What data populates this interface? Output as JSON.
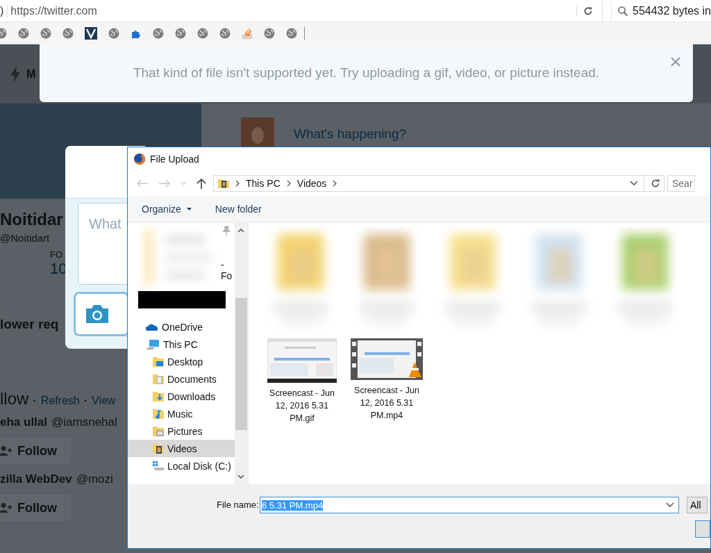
{
  "browser": {
    "url_cut": ")",
    "url": "https://twitter.com",
    "search_value": "554432 bytes in"
  },
  "toast": {
    "message": "That kind of file isn't supported yet. Try uploading a gif, video, or picture instead."
  },
  "twitter": {
    "nav_label": "M",
    "compose_prompt": "What's happening?",
    "profile_name": "Noitidar",
    "handle": "@Noitidart",
    "stat_label": "FO",
    "stat_value": "10",
    "follower_requests": "lower req",
    "follow_title": "llow",
    "follow_separator": "·",
    "follow_links": [
      "Refresh",
      "View"
    ],
    "suggestions": [
      {
        "name": "eha ullal",
        "handle": "@iamsnehal",
        "button": "Follow"
      },
      {
        "name": "zilla WebDev",
        "handle": "@mozi",
        "button": "Follow"
      }
    ]
  },
  "tweet_modal": {
    "placeholder": "What"
  },
  "dialog": {
    "title": "File Upload",
    "path": [
      "This PC",
      "Videos"
    ],
    "search_placeholder": "Sear",
    "toolbar": [
      {
        "label": "Organize",
        "menu": true
      },
      {
        "label": "New folder",
        "menu": false
      }
    ],
    "nav_cut_text": "-Fo",
    "nav": [
      {
        "label": "OneDrive",
        "kind": "cloud",
        "selected": false
      },
      {
        "label": "This PC",
        "kind": "pc",
        "selected": false,
        "children": [
          {
            "label": "Desktop",
            "kind": "desktop",
            "selected": false
          },
          {
            "label": "Documents",
            "kind": "documents",
            "selected": false
          },
          {
            "label": "Downloads",
            "kind": "downloads",
            "selected": false
          },
          {
            "label": "Music",
            "kind": "music",
            "selected": false
          },
          {
            "label": "Pictures",
            "kind": "pictures",
            "selected": false
          },
          {
            "label": "Videos",
            "kind": "videos",
            "selected": true
          },
          {
            "label": "Local Disk (C:)",
            "kind": "disk",
            "selected": false
          }
        ]
      }
    ],
    "files": [
      {
        "name": "Screencast - Jun 12, 2016 5.31 PM.gif",
        "kind": "gif",
        "selected": false
      },
      {
        "name": "Screencast - Jun 12, 2016 5.31 PM.mp4",
        "kind": "video",
        "selected": false
      }
    ],
    "file_name": {
      "label": "File name:",
      "value": "6 5.31 PM.mp4",
      "selected_text": true
    },
    "file_type": "All"
  }
}
